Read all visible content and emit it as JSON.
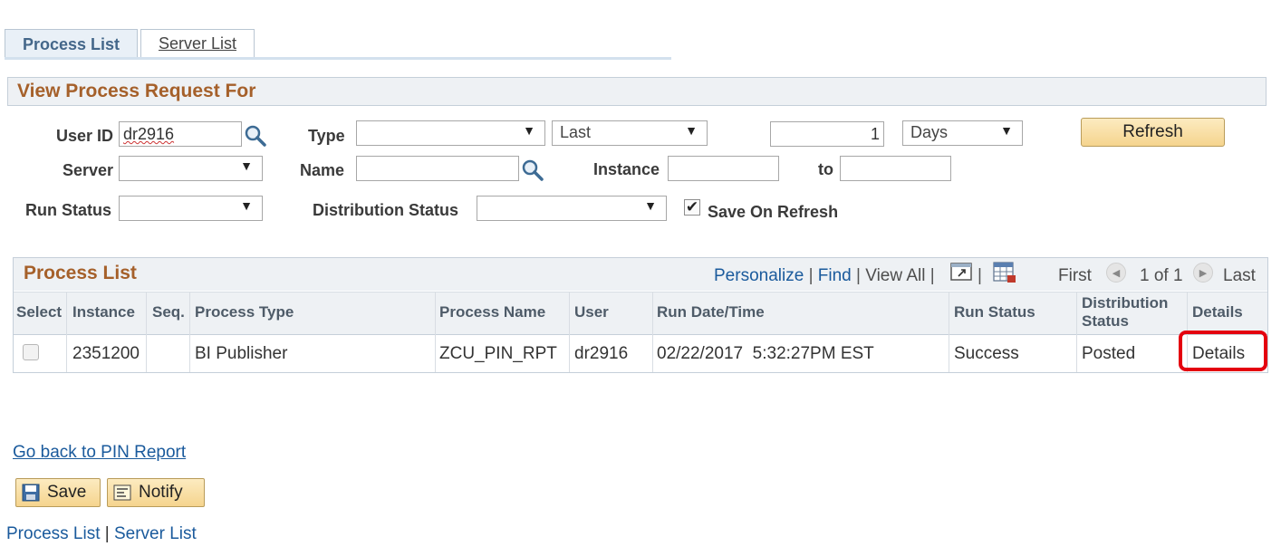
{
  "tabs": {
    "process_list": "Process List",
    "server_list": "Server List"
  },
  "section": {
    "title": "View Process Request For"
  },
  "filters": {
    "user_id_label": "User ID",
    "user_id_value": "dr2916",
    "type_label": "Type",
    "type_value": "",
    "last_value": "Last",
    "days_count": "1",
    "days_unit": "Days",
    "refresh_label": "Refresh",
    "server_label": "Server",
    "server_value": "",
    "name_label": "Name",
    "name_value": "",
    "instance_label": "Instance",
    "instance_from": "",
    "to_label": "to",
    "instance_to": "",
    "run_status_label": "Run Status",
    "run_status_value": "",
    "dist_status_label": "Distribution Status",
    "dist_status_value": "",
    "save_on_refresh_label": "Save On Refresh",
    "save_on_refresh_checked": true
  },
  "grid": {
    "title": "Process List",
    "personalize": "Personalize",
    "find": "Find",
    "view_all": "View All",
    "first": "First",
    "count": "1 of 1",
    "last": "Last",
    "headers": {
      "select": "Select",
      "instance": "Instance",
      "seq": "Seq.",
      "process_type": "Process Type",
      "process_name": "Process Name",
      "user": "User",
      "run_datetime": "Run Date/Time",
      "run_status": "Run Status",
      "distribution_status_1": "Distribution",
      "distribution_status_2": "Status",
      "details": "Details"
    },
    "rows": [
      {
        "instance": "2351200",
        "seq": "",
        "process_type": "BI Publisher",
        "process_name": "ZCU_PIN_RPT",
        "user": "dr2916",
        "run_datetime": "02/22/2017  5:32:27PM EST",
        "run_status": "Success",
        "distribution_status": "Posted",
        "details": "Details"
      }
    ]
  },
  "footer": {
    "go_back": "Go back to PIN Report",
    "save": "Save",
    "notify": "Notify",
    "process_list_link": "Process List",
    "server_list_link": "Server List",
    "sep": "|"
  },
  "colors": {
    "accent": "#a5602a",
    "link": "#1a5a9c",
    "highlight": "#e4000f"
  }
}
